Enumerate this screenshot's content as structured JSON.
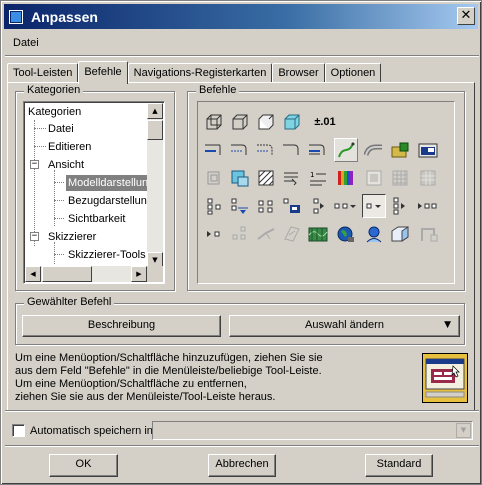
{
  "window": {
    "title": "Anpassen",
    "close": "✕"
  },
  "menu": {
    "datei": "Datei"
  },
  "tabs": [
    "Tool-Leisten",
    "Befehle",
    "Navigations-Registerkarten",
    "Browser",
    "Optionen"
  ],
  "kategorien": {
    "group_label": "Kategorien",
    "items": [
      "Kategorien",
      "Datei",
      "Editieren",
      "Ansicht",
      "Modelldarstellung",
      "Bezugdarstellung",
      "Sichtbarkeit",
      "Skizzierer",
      "Skizzierer-Tools"
    ],
    "selected": "Modelldarstellung"
  },
  "befehle": {
    "group_label": "Befehle",
    "dimension_label": "±.01"
  },
  "gewaehlter_befehl": {
    "group_label": "Gewählter Befehl",
    "beschreibung": "Beschreibung",
    "auswahl": "Auswahl ändern",
    "dropdown_arrow": "▼"
  },
  "help_text": "Um eine Menüoption/Schaltfläche hinzuzufügen, ziehen Sie sie\naus dem Feld \"Befehle\" in die Menüleiste/beliebige Tool-Leiste.\nUm eine Menüoption/Schaltfläche zu entfernen,\nziehen Sie sie aus der Menüleiste/Tool-Leiste heraus.",
  "autosave": {
    "label": "Automatisch speichern in",
    "value": ""
  },
  "footer": {
    "ok": "OK",
    "abbrechen": "Abbrechen",
    "standard": "Standard"
  },
  "colors": {
    "title_start": "#0a246a",
    "title_end": "#a6caf0",
    "face": "#d4d0c8",
    "selection": "#808080"
  }
}
